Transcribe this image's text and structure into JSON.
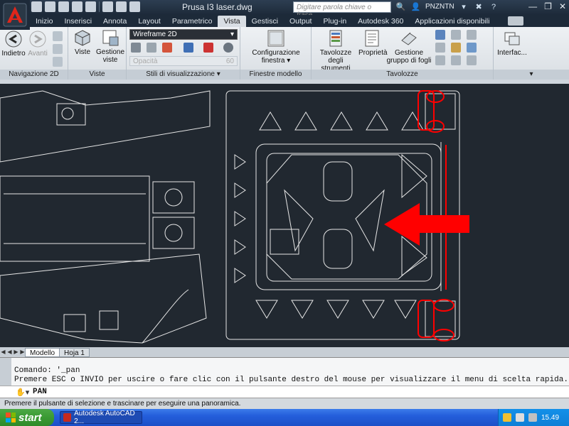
{
  "window": {
    "title": "Prusa I3  laser.dwg",
    "search_placeholder": "Digitare parola chiave o frase",
    "user": "PNZNTN"
  },
  "menu_tabs": [
    {
      "label": "Inizio"
    },
    {
      "label": "Inserisci"
    },
    {
      "label": "Annota"
    },
    {
      "label": "Layout"
    },
    {
      "label": "Parametrico"
    },
    {
      "label": "Vista",
      "active": true
    },
    {
      "label": "Gestisci"
    },
    {
      "label": "Output"
    },
    {
      "label": "Plug-in"
    },
    {
      "label": "Autodesk 360"
    },
    {
      "label": "Applicazioni disponibili"
    }
  ],
  "ribbon": {
    "nav": {
      "back_label": "Indietro",
      "forward_label": "Avanti",
      "panel_title": "Navigazione 2D"
    },
    "views": {
      "views_label": "Viste",
      "manage_label": "Gestione viste",
      "panel_title": "Viste"
    },
    "visual_styles": {
      "style_value": "Wireframe 2D",
      "opacity_label": "Opacità",
      "opacity_value": "60",
      "panel_title": "Stili di visualizzazione"
    },
    "model_viewports": {
      "config_label": "Configurazione finestra",
      "panel_title": "Finestre modello"
    },
    "palettes": {
      "tool_palettes_label": "Tavolozze degli strumenti",
      "properties_label": "Proprietà",
      "sheet_set_label": "Gestione gruppo di fogli",
      "panel_title": "Tavolozze"
    },
    "interface": {
      "label": "Interfac..."
    }
  },
  "layout_tabs": [
    {
      "label": "Modello",
      "active": true
    },
    {
      "label": "Hoja 1"
    }
  ],
  "command_line": {
    "history": [
      "Comando: '_pan",
      "Premere ESC o INVIO per uscire o fare clic con il pulsante destro del mouse per visualizzare il menu di scelta rapida."
    ],
    "current": "PAN"
  },
  "status_text": "Premere il pulsante di selezione e trascinare per eseguire una panoramica.",
  "taskbar": {
    "start_label": "start",
    "task_label": "Autodesk AutoCAD 2...",
    "clock": "15.49"
  },
  "colors": {
    "drawing_bg": "#212830",
    "linework": "#e6e6e6",
    "annotation": "#ff0000"
  }
}
